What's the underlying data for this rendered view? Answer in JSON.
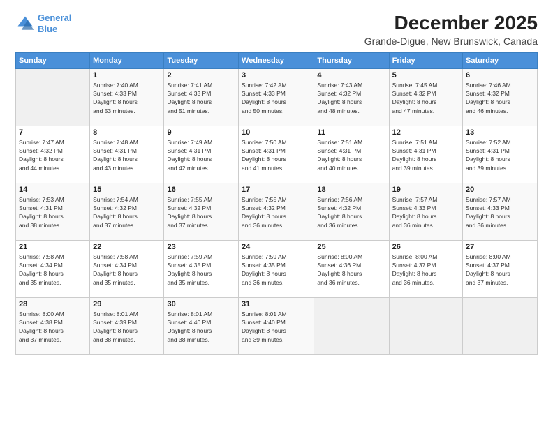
{
  "logo": {
    "line1": "General",
    "line2": "Blue"
  },
  "title": "December 2025",
  "location": "Grande-Digue, New Brunswick, Canada",
  "weekdays": [
    "Sunday",
    "Monday",
    "Tuesday",
    "Wednesday",
    "Thursday",
    "Friday",
    "Saturday"
  ],
  "weeks": [
    [
      {
        "day": "",
        "info": ""
      },
      {
        "day": "1",
        "info": "Sunrise: 7:40 AM\nSunset: 4:33 PM\nDaylight: 8 hours\nand 53 minutes."
      },
      {
        "day": "2",
        "info": "Sunrise: 7:41 AM\nSunset: 4:33 PM\nDaylight: 8 hours\nand 51 minutes."
      },
      {
        "day": "3",
        "info": "Sunrise: 7:42 AM\nSunset: 4:33 PM\nDaylight: 8 hours\nand 50 minutes."
      },
      {
        "day": "4",
        "info": "Sunrise: 7:43 AM\nSunset: 4:32 PM\nDaylight: 8 hours\nand 48 minutes."
      },
      {
        "day": "5",
        "info": "Sunrise: 7:45 AM\nSunset: 4:32 PM\nDaylight: 8 hours\nand 47 minutes."
      },
      {
        "day": "6",
        "info": "Sunrise: 7:46 AM\nSunset: 4:32 PM\nDaylight: 8 hours\nand 46 minutes."
      }
    ],
    [
      {
        "day": "7",
        "info": "Sunrise: 7:47 AM\nSunset: 4:32 PM\nDaylight: 8 hours\nand 44 minutes."
      },
      {
        "day": "8",
        "info": "Sunrise: 7:48 AM\nSunset: 4:31 PM\nDaylight: 8 hours\nand 43 minutes."
      },
      {
        "day": "9",
        "info": "Sunrise: 7:49 AM\nSunset: 4:31 PM\nDaylight: 8 hours\nand 42 minutes."
      },
      {
        "day": "10",
        "info": "Sunrise: 7:50 AM\nSunset: 4:31 PM\nDaylight: 8 hours\nand 41 minutes."
      },
      {
        "day": "11",
        "info": "Sunrise: 7:51 AM\nSunset: 4:31 PM\nDaylight: 8 hours\nand 40 minutes."
      },
      {
        "day": "12",
        "info": "Sunrise: 7:51 AM\nSunset: 4:31 PM\nDaylight: 8 hours\nand 39 minutes."
      },
      {
        "day": "13",
        "info": "Sunrise: 7:52 AM\nSunset: 4:31 PM\nDaylight: 8 hours\nand 39 minutes."
      }
    ],
    [
      {
        "day": "14",
        "info": "Sunrise: 7:53 AM\nSunset: 4:31 PM\nDaylight: 8 hours\nand 38 minutes."
      },
      {
        "day": "15",
        "info": "Sunrise: 7:54 AM\nSunset: 4:32 PM\nDaylight: 8 hours\nand 37 minutes."
      },
      {
        "day": "16",
        "info": "Sunrise: 7:55 AM\nSunset: 4:32 PM\nDaylight: 8 hours\nand 37 minutes."
      },
      {
        "day": "17",
        "info": "Sunrise: 7:55 AM\nSunset: 4:32 PM\nDaylight: 8 hours\nand 36 minutes."
      },
      {
        "day": "18",
        "info": "Sunrise: 7:56 AM\nSunset: 4:32 PM\nDaylight: 8 hours\nand 36 minutes."
      },
      {
        "day": "19",
        "info": "Sunrise: 7:57 AM\nSunset: 4:33 PM\nDaylight: 8 hours\nand 36 minutes."
      },
      {
        "day": "20",
        "info": "Sunrise: 7:57 AM\nSunset: 4:33 PM\nDaylight: 8 hours\nand 36 minutes."
      }
    ],
    [
      {
        "day": "21",
        "info": "Sunrise: 7:58 AM\nSunset: 4:34 PM\nDaylight: 8 hours\nand 35 minutes."
      },
      {
        "day": "22",
        "info": "Sunrise: 7:58 AM\nSunset: 4:34 PM\nDaylight: 8 hours\nand 35 minutes."
      },
      {
        "day": "23",
        "info": "Sunrise: 7:59 AM\nSunset: 4:35 PM\nDaylight: 8 hours\nand 35 minutes."
      },
      {
        "day": "24",
        "info": "Sunrise: 7:59 AM\nSunset: 4:35 PM\nDaylight: 8 hours\nand 36 minutes."
      },
      {
        "day": "25",
        "info": "Sunrise: 8:00 AM\nSunset: 4:36 PM\nDaylight: 8 hours\nand 36 minutes."
      },
      {
        "day": "26",
        "info": "Sunrise: 8:00 AM\nSunset: 4:37 PM\nDaylight: 8 hours\nand 36 minutes."
      },
      {
        "day": "27",
        "info": "Sunrise: 8:00 AM\nSunset: 4:37 PM\nDaylight: 8 hours\nand 37 minutes."
      }
    ],
    [
      {
        "day": "28",
        "info": "Sunrise: 8:00 AM\nSunset: 4:38 PM\nDaylight: 8 hours\nand 37 minutes."
      },
      {
        "day": "29",
        "info": "Sunrise: 8:01 AM\nSunset: 4:39 PM\nDaylight: 8 hours\nand 38 minutes."
      },
      {
        "day": "30",
        "info": "Sunrise: 8:01 AM\nSunset: 4:40 PM\nDaylight: 8 hours\nand 38 minutes."
      },
      {
        "day": "31",
        "info": "Sunrise: 8:01 AM\nSunset: 4:40 PM\nDaylight: 8 hours\nand 39 minutes."
      },
      {
        "day": "",
        "info": ""
      },
      {
        "day": "",
        "info": ""
      },
      {
        "day": "",
        "info": ""
      }
    ]
  ]
}
